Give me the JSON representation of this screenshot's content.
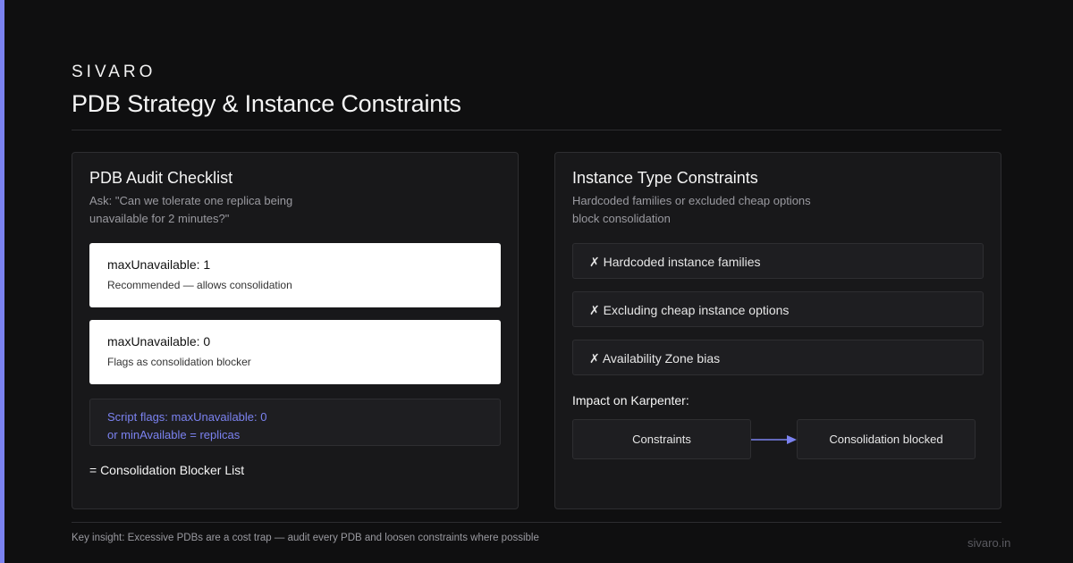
{
  "brand": "SIVARO",
  "title": "PDB Strategy & Instance Constraints",
  "left_panel": {
    "title": "PDB Audit Checklist",
    "subtitle_line1": "Ask: \"Can we tolerate one replica being",
    "subtitle_line2": "unavailable for 2 minutes?\"",
    "cards": [
      {
        "title": "maxUnavailable: 1",
        "desc": "Recommended — allows consolidation"
      },
      {
        "title": "maxUnavailable: 0",
        "desc": "Flags as consolidation blocker"
      }
    ],
    "script_line1": "Script flags: maxUnavailable: 0",
    "script_line2": "or minAvailable = replicas",
    "result": "= Consolidation Blocker List"
  },
  "right_panel": {
    "title": "Instance Type Constraints",
    "subtitle_line1": "Hardcoded families or excluded cheap options",
    "subtitle_line2": "block consolidation",
    "items": [
      "✗ Hardcoded instance families",
      "✗ Excluding cheap instance options",
      "✗ Availability Zone bias"
    ],
    "impact_label": "Impact on Karpenter:",
    "flow_from": "Constraints",
    "flow_to": "Consolidation blocked"
  },
  "footer": {
    "insight": "Key insight: Excessive PDBs are a cost trap — audit every PDB and loosen constraints where possible",
    "site": "sivaro.in"
  },
  "colors": {
    "accent": "#7b82f0",
    "background": "#0f0f10",
    "panel": "#18181a"
  }
}
